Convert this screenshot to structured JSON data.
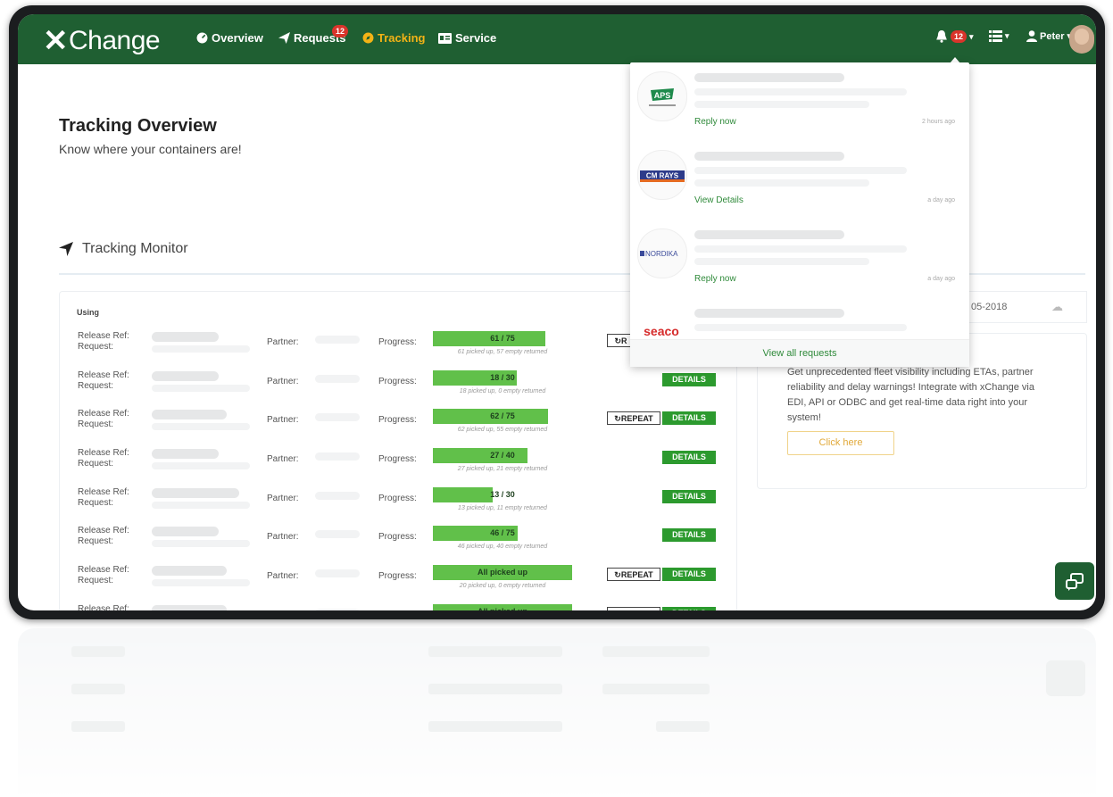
{
  "app": {
    "logo_x": "✕",
    "logo_text": "Change"
  },
  "nav": {
    "items": [
      {
        "label": "Overview",
        "icon": "dashboard-icon"
      },
      {
        "label": "Requests",
        "icon": "send-icon",
        "badge": "12"
      },
      {
        "label": "Tracking",
        "icon": "compass-icon",
        "active": true
      },
      {
        "label": "Service",
        "icon": "service-icon"
      }
    ],
    "bell_badge": "12",
    "user_label": "Peter"
  },
  "page": {
    "title": "Tracking Overview",
    "subtitle": "Know where your containers are!"
  },
  "monitor": {
    "title": "Tracking Monitor",
    "using_label": "Using",
    "release_label": "Release Ref:",
    "request_label": "Request:",
    "partner_label": "Partner:",
    "progress_label": "Progress:",
    "repeat_label": "REPEAT",
    "details_label": "DETAILS",
    "rows": [
      {
        "progress_text": "61 / 75",
        "sub": "61 picked up, 57 empty returned",
        "fraction": 0.81,
        "repeat": true,
        "details": false,
        "repeat_partial": "R"
      },
      {
        "progress_text": "18 / 30",
        "sub": "18 picked up, 0 empty returned",
        "fraction": 0.6,
        "repeat": false,
        "details": true
      },
      {
        "progress_text": "62 / 75",
        "sub": "62 picked up, 55 empty returned",
        "fraction": 0.83,
        "repeat": true,
        "details": true
      },
      {
        "progress_text": "27 / 40",
        "sub": "27 picked up, 21 empty returned",
        "fraction": 0.68,
        "repeat": false,
        "details": true
      },
      {
        "progress_text": "13 / 30",
        "sub": "13 picked up, 11 empty returned",
        "fraction": 0.43,
        "repeat": false,
        "details": true
      },
      {
        "progress_text": "46 / 75",
        "sub": "46 picked up, 40 empty returned",
        "fraction": 0.61,
        "repeat": false,
        "details": true
      },
      {
        "progress_text": "All picked up",
        "sub": "20 picked up, 0 empty returned",
        "fraction": 1.0,
        "repeat": true,
        "details": true
      },
      {
        "progress_text": "All picked up",
        "sub": "",
        "fraction": 1.0,
        "repeat": true,
        "details": true
      }
    ]
  },
  "side": {
    "date": "05-2018",
    "text": "Get unprecedented fleet visibility including ETAs, partner reliability and delay warnings! Integrate with xChange via EDI, API or ODBC and get real-time data right into your system!",
    "button": "Click here"
  },
  "notifications": {
    "items": [
      {
        "logo": "APS",
        "link": "Reply now",
        "time": "2 hours ago"
      },
      {
        "logo": "CM RAYS",
        "link": "View Details",
        "time": "a day ago"
      },
      {
        "logo": "NORDIKA",
        "link": "Reply now",
        "time": "a day ago"
      },
      {
        "logo": "seaco",
        "link": "",
        "time": ""
      }
    ],
    "footer": "View all requests"
  },
  "colors": {
    "brand": "#1f5f32",
    "accent": "#f3b316",
    "progress": "#61c04a",
    "details": "#2c9a2e"
  }
}
